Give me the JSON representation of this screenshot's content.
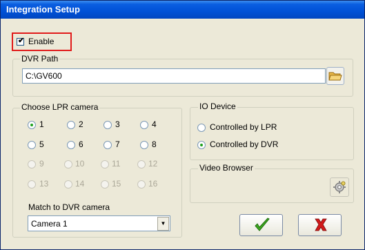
{
  "window": {
    "title": "Integration Setup"
  },
  "enable": {
    "label": "Enable",
    "checked": true,
    "check_glyph": "✔"
  },
  "dvr_path": {
    "title": "DVR Path",
    "value": "C:\\GV600",
    "browse_icon": "folder-icon"
  },
  "lpr_camera": {
    "title": "Choose LPR camera",
    "options": [
      "1",
      "2",
      "3",
      "4",
      "5",
      "6",
      "7",
      "8",
      "9",
      "10",
      "11",
      "12",
      "13",
      "14",
      "15",
      "16"
    ],
    "selected": "1",
    "enabled_count": 8,
    "match_label": "Match to DVR camera",
    "match_value": "Camera 1",
    "dropdown_glyph": "▼"
  },
  "io_device": {
    "title": "IO Device",
    "options": [
      "Controlled by LPR",
      "Controlled by DVR"
    ],
    "selected": "Controlled by DVR"
  },
  "video_browser": {
    "title": "Video Browser",
    "button_icon": "video-settings-icon"
  },
  "actions": {
    "ok_icon": "green-checkmark-icon",
    "cancel_icon": "red-x-icon"
  },
  "colors": {
    "title_bar": "#0051d6",
    "window_bg": "#ece9d8",
    "highlight_border": "#e11a1a",
    "check_green": "#21a121",
    "cancel_red": "#d21a1a"
  }
}
